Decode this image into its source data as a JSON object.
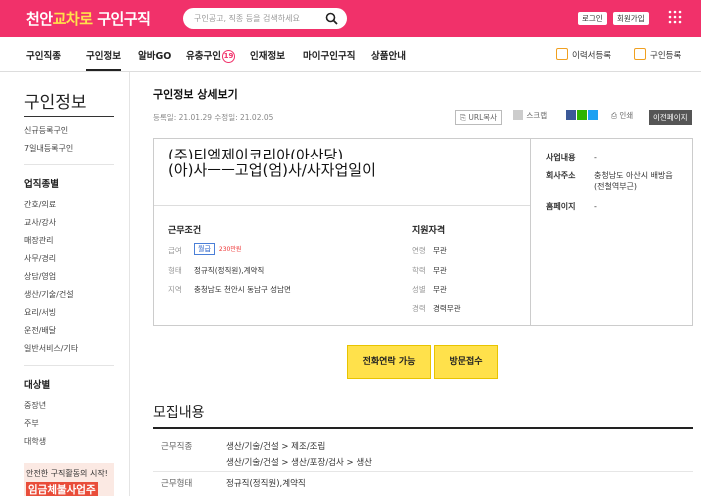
{
  "header": {
    "logo_part1": "천안",
    "logo_part2": "교차로",
    "logo_part3": " 구인구직",
    "search_placeholder": "구인공고, 직종 등을 검색하세요",
    "login": "로그인",
    "signup": "회원가입",
    "brand_color": "#f1316a"
  },
  "nav": {
    "items": [
      "구인직종",
      "구인정보",
      "알바GO",
      "유충구인",
      "인재정보",
      "마이구인구직",
      "상품안내"
    ],
    "badge": "19",
    "resume": "이력서등록",
    "job_post": "구인등록"
  },
  "sidebar": {
    "title": "구인정보",
    "links_top": [
      "신규등록구인",
      "7일내등록구인"
    ],
    "section1": "업직종별",
    "categories": [
      "간호/의료",
      "교사/강사",
      "매장관리",
      "사무/경리",
      "상담/영업",
      "생산/기술/건설",
      "요리/서빙",
      "운전/배달",
      "일반서비스/기타"
    ],
    "section2": "대상별",
    "targets": [
      "중장년",
      "주부",
      "대학생"
    ],
    "banner_line1": "안전한 구직활동의 시작!",
    "banner_line2": "임금체불사업주"
  },
  "main": {
    "title": "구인정보 상세보기",
    "dates": "등록일: 21.01.29   수정일: 21.02.05",
    "tool_url": "URL복사",
    "tool_scrap": "스크랩",
    "tool_print": "인쇄",
    "tool_prev": "이전페이지",
    "company_line1": "(주)티엠제이코리아(아산당)",
    "company_line2": "(아)사ㅡㅡ고업(엄)사/사자업일이",
    "conditions": {
      "heading": "근무조건",
      "pay_label": "급여",
      "pay_type": "월급",
      "pay_amount": "230만원",
      "type_label": "형태",
      "type_value": "정규직(정직원),계약직",
      "area_label": "지역",
      "area_value": "충청남도 천안시 동남구 성남면"
    },
    "qualifications": {
      "heading": "지원자격",
      "age_label": "연령",
      "age_value": "무관",
      "edu_label": "학력",
      "edu_value": "무관",
      "gender_label": "성별",
      "gender_value": "무관",
      "career_label": "경력",
      "career_value": "경력무관"
    },
    "company_info": {
      "biz_label": "사업내용",
      "biz_value": "-",
      "addr_label": "회사주소",
      "addr_value": "충청남도 아산시 배방읍 (전철역부근)",
      "home_label": "홈페이지",
      "home_value": "-"
    },
    "cta_call": "전화연락 가능",
    "cta_visit": "방문접수",
    "recruit": {
      "title": "모집내용",
      "field_label": "근무직종",
      "field_value1": "생산/기술/건설 > 제조/조립",
      "field_value2": "생산/기술/건설 > 생산/포장/검사 > 생산",
      "type_label": "근무형태",
      "type_value": "정규직(정직원),계약직"
    }
  }
}
